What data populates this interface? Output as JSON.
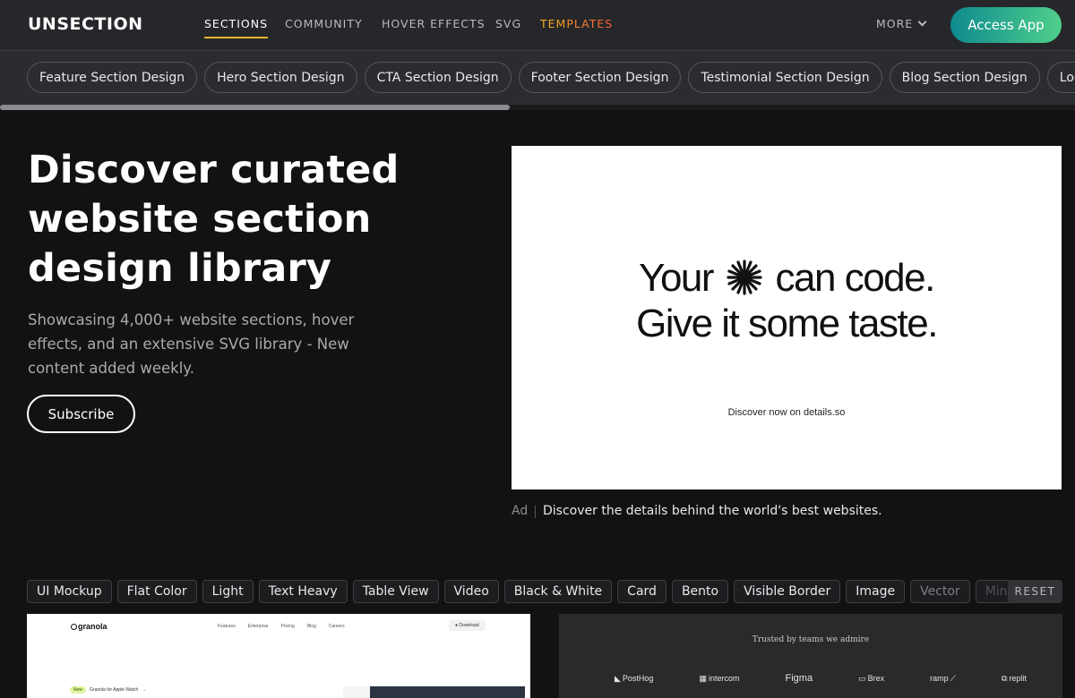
{
  "brand": "UNSECTION",
  "nav": {
    "links": [
      "SECTIONS",
      "COMMUNITY",
      "HOVER EFFECTS",
      "SVG",
      "TEMPLATES"
    ],
    "active": "SECTIONS",
    "more_label": "MORE",
    "access_label": "Access App",
    "accent_colors": {
      "active_underline": "#f0b429",
      "templates_gradient": [
        "#f5b820",
        "#ff5a36"
      ],
      "access_gradient": [
        "#0f8a8f",
        "#4fd08c"
      ]
    }
  },
  "categories": [
    "Feature Section Design",
    "Hero Section Design",
    "CTA Section Design",
    "Footer Section Design",
    "Testimonial Section Design",
    "Blog Section Design",
    "Logo Section"
  ],
  "hero": {
    "title": "Discover curated website section design library",
    "subtitle": "Showcasing 4,000+ website sections, hover effects, and an extensive SVG library - New content added weekly.",
    "subscribe_label": "Subscribe"
  },
  "ad": {
    "line1_before": "Your",
    "line1_after": "can code.",
    "line2": "Give it some taste.",
    "small": "Discover now on details.so",
    "tag": "Ad",
    "caption": "Discover the details behind the world's best websites."
  },
  "filters": [
    "UI Mockup",
    "Flat Color",
    "Light",
    "Text Heavy",
    "Table View",
    "Video",
    "Black & White",
    "Card",
    "Bento",
    "Visible Border",
    "Image",
    "Vector",
    "Mini"
  ],
  "reset_label": "RESET",
  "card1": {
    "logo": "granola",
    "nav": [
      "Features",
      "Enterprise",
      "Pricing",
      "Blog",
      "Careers"
    ],
    "download": "Download",
    "badge_new": "New",
    "badge_text": "Granola for Apple Watch"
  },
  "card2": {
    "title": "Trusted by teams we admire",
    "logos": [
      "PostHog",
      "intercom",
      "Figma",
      "Brex",
      "ramp",
      "replit"
    ]
  }
}
